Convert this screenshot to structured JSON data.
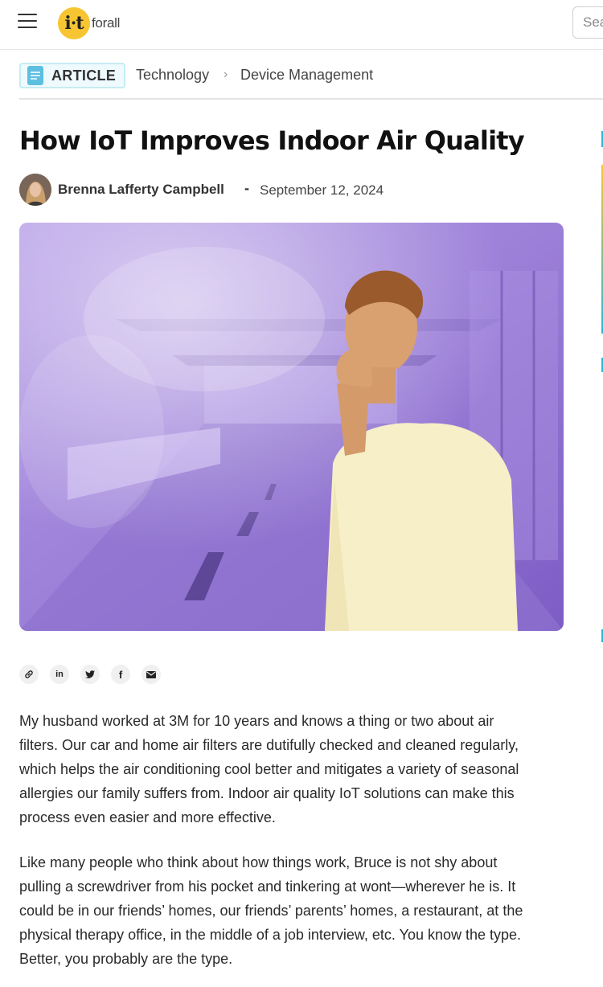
{
  "header": {
    "logo_letters": "i·t",
    "logo_text": "forall",
    "search_placeholder": "Search"
  },
  "breadcrumb": {
    "badge": "ARTICLE",
    "items": [
      "Technology",
      "Device Management"
    ]
  },
  "article": {
    "title": "How IoT Improves Indoor Air Quality",
    "author": "Brenna Lafferty Campbell",
    "separator": "-",
    "date": "September 12, 2024",
    "share_icons": [
      "link-icon",
      "linkedin-icon",
      "twitter-icon",
      "facebook-icon",
      "email-icon"
    ],
    "share_glyphs": {
      "linkedin": "in",
      "facebook": "f"
    },
    "paragraphs": [
      {
        "lines": [
          "My husband worked at 3M for 10 years and knows a thing or two about air",
          "filters. Our car and home air filters are dutifully checked and cleaned regularly,",
          "which helps the air conditioning cool better and mitigates a variety of seasonal",
          "allergies our family suffers from. Indoor air quality IoT solutions can make this",
          "process even easier and more effective."
        ]
      },
      {
        "lines": [
          "Like many people who think about how things work, Bruce is not shy about",
          "pulling a screwdriver from his pocket and tinkering at wont—wherever he is. It",
          "could be in our friends’ homes, our friends’ parents’ homes, a restaurant, at the",
          "physical therapy office, in the middle of a job interview, etc. You know the type.",
          "Better, you probably are the type."
        ]
      }
    ]
  },
  "colors": {
    "logo_yellow": "#f7c531",
    "logo_blue": "#2db4d4",
    "hero_purple": "#9b7fd6",
    "badge_bg": "#eefafd"
  }
}
